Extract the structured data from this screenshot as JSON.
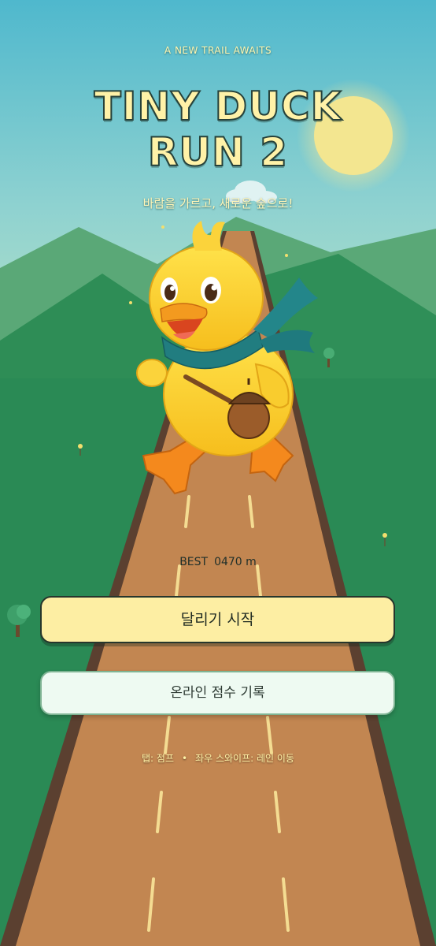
{
  "header": {
    "tagline": "A NEW TRAIL AWAITS",
    "title_line1": "TINY DUCK",
    "title_line2": "RUN 2",
    "subtitle": "바람을 가르고, 새로운 숲으로!"
  },
  "score": {
    "best_label": "BEST",
    "best_value": "0470 m"
  },
  "buttons": {
    "start_label": "달리기 시작",
    "online_label": "온라인 점수 기록"
  },
  "help": {
    "tap": "탭: 점프",
    "separator": "•",
    "swipe": "좌우 스와이프: 레인 이동"
  },
  "colors": {
    "sky_top": "#56bcd0",
    "sky_bottom": "#a8dcc8",
    "sun": "#f3e690",
    "mountain_far": "#5aa877",
    "mountain_near": "#2e8d56",
    "grass": "#2a8a55",
    "road": "#c28651",
    "road_edge": "#5b4030",
    "lane_dash": "#f4dc92",
    "duck_body": "#fdd535",
    "duck_beak": "#f39a1f",
    "scarf": "#217d80",
    "start_button": "#fdeea3"
  },
  "icons": {
    "mascot": "duck-mascot",
    "sun": "sun-icon",
    "tree": "tree-icon",
    "bag": "acorn-bag-icon"
  }
}
